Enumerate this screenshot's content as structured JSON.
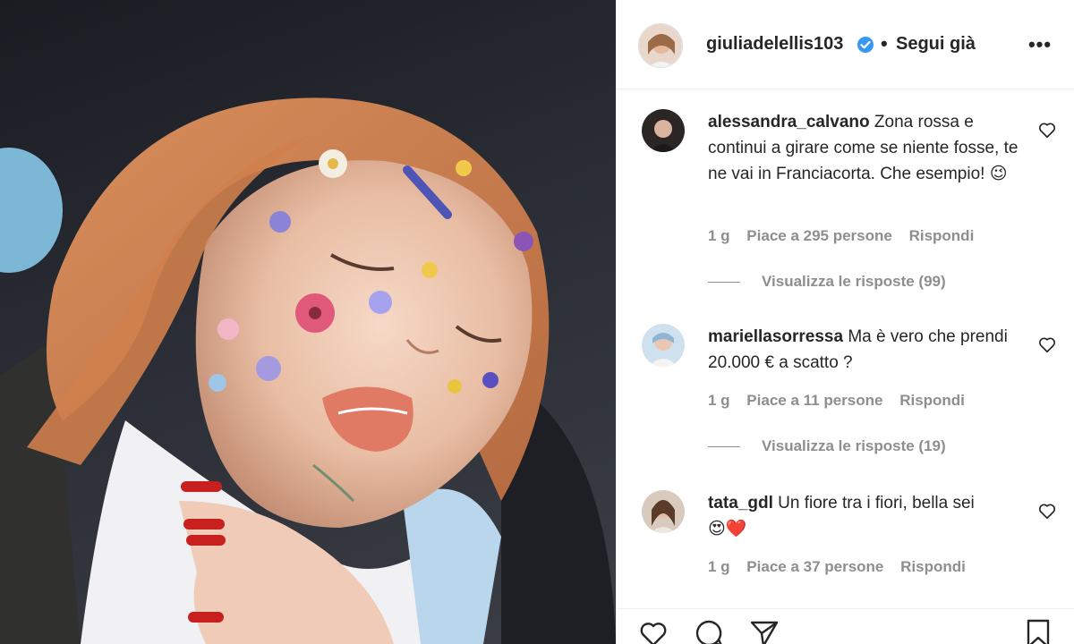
{
  "photo": {
    "alt": ""
  },
  "header": {
    "username": "giulia­delellis103",
    "separator": "•",
    "follow_label": "Segui già",
    "more_label": "•••"
  },
  "comments": [
    {
      "username": "alessandra_calvano",
      "text": "Zona rossa e continui a girare come se niente fosse, te ne vai in Franciacorta. Che esempio!",
      "emoji": "😉",
      "time": "1 g",
      "likes": "Piace a 295 persone",
      "reply": "Rispondi",
      "view_replies": "Visualizza le risposte (99)"
    },
    {
      "username": "mariellasorressa",
      "text": "Ma è vero che prendi 20.000 € a scatto ?",
      "emoji": "",
      "time": "1 g",
      "likes": "Piace a 11 persone",
      "reply": "Rispondi",
      "view_replies": "Visualizza le risposte (19)"
    },
    {
      "username": "tata_gdl",
      "text": "Un fiore tra i fiori, bella sei",
      "emoji": "😍❤️",
      "time": "1 g",
      "likes": "Piace a 37 persone",
      "reply": "Rispondi",
      "view_replies": ""
    }
  ],
  "colors": {
    "verified": "#3897f0",
    "meta": "#8e8e8e",
    "text": "#262626"
  },
  "icons": [
    "heart-icon",
    "comment-icon",
    "share-icon",
    "bookmark-icon"
  ]
}
